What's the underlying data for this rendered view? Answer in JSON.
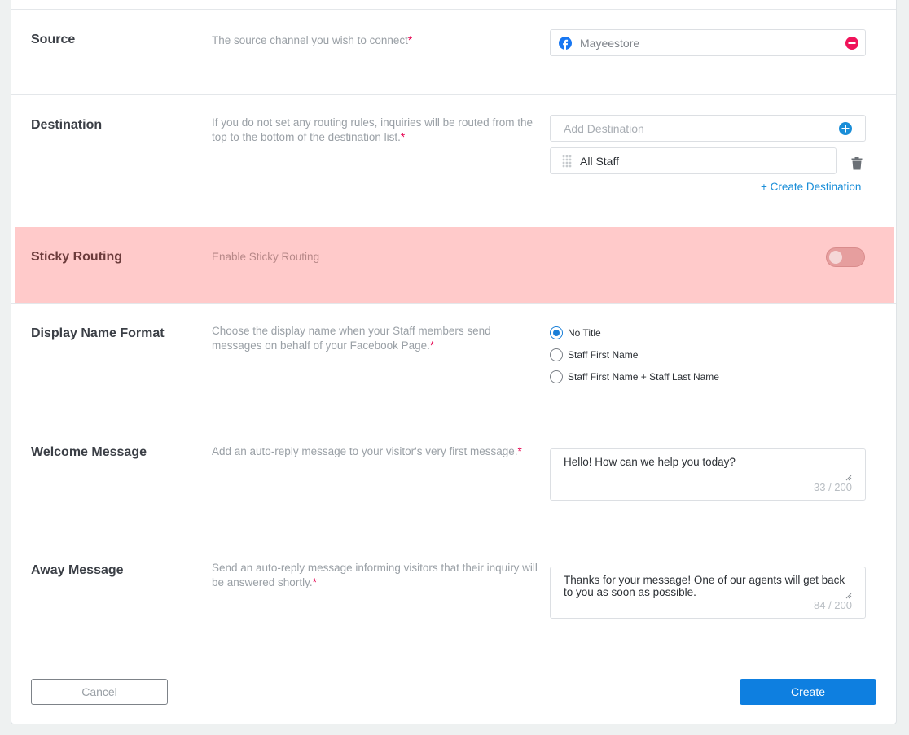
{
  "source": {
    "title": "Source",
    "description": "The source channel you wish to connect",
    "required_mark": "*",
    "channel_name": "Mayeestore",
    "channel_icon": "facebook-icon",
    "remove_icon": "minus-circle-icon"
  },
  "destination": {
    "title": "Destination",
    "description": "If you do not set any routing rules, inquiries will be routed from the top to the bottom of the destination list.",
    "required_mark": "*",
    "add_placeholder": "Add Destination",
    "items": [
      {
        "label": "All Staff"
      }
    ],
    "create_link": "+ Create Destination"
  },
  "sticky_routing": {
    "title": "Sticky Routing",
    "description": "Enable Sticky Routing",
    "enabled": false
  },
  "display_name_format": {
    "title": "Display Name Format",
    "description": "Choose the display name when your Staff members send messages on behalf of your Facebook Page.",
    "required_mark": "*",
    "options": [
      {
        "label": "No Title",
        "selected": true
      },
      {
        "label": "Staff First Name",
        "selected": false
      },
      {
        "label": "Staff First Name + Staff Last Name",
        "selected": false
      }
    ]
  },
  "welcome_message": {
    "title": "Welcome Message",
    "description": "Add an auto-reply message to your visitor's very first message.",
    "required_mark": "*",
    "value": "Hello! How can we help you today?",
    "counter": "33 / 200"
  },
  "away_message": {
    "title": "Away Message",
    "description": "Send an auto-reply message informing visitors that their inquiry will be answered shortly.",
    "required_mark": "*",
    "value": "Thanks for your message! One of our agents will get back to you as soon as possible.",
    "counter": "84 / 200"
  },
  "footer": {
    "cancel_label": "Cancel",
    "create_label": "Create"
  },
  "colors": {
    "accent": "#0e7fe0",
    "required": "#e5004f",
    "sticky_highlight": "#ffcaca",
    "facebook": "#1877f2"
  }
}
